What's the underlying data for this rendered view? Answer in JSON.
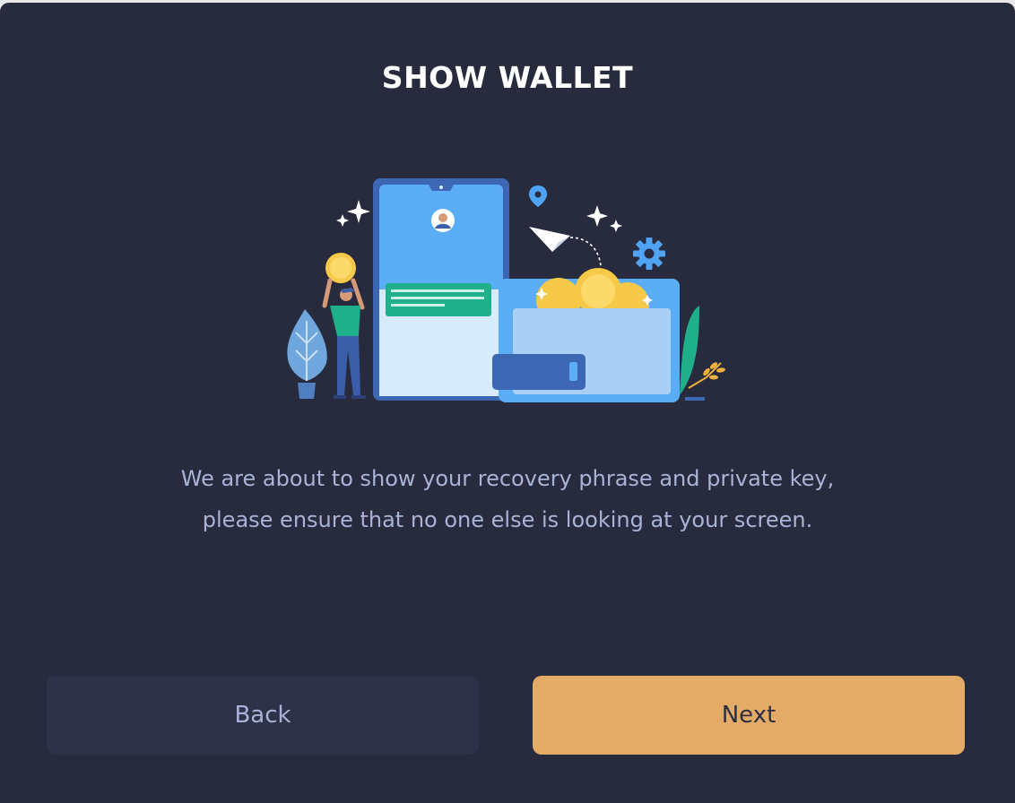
{
  "dialog": {
    "title": "SHOW WALLET",
    "message_line1": "We are about to show your recovery phrase and private key,",
    "message_line2": "please ensure that no one else is looking at your screen."
  },
  "buttons": {
    "back_label": "Back",
    "next_label": "Next"
  },
  "colors": {
    "background": "#272b3d",
    "title": "#ffffff",
    "message": "#a9b3d6",
    "back_button": "#2e3248",
    "next_button": "#e4ab67"
  },
  "illustration": {
    "icons": [
      "phone-icon",
      "wallet-icon",
      "coin-icon",
      "person-icon",
      "plant-icon",
      "paper-plane-icon",
      "gear-icon",
      "location-pin-icon",
      "sparkle-icon"
    ]
  }
}
